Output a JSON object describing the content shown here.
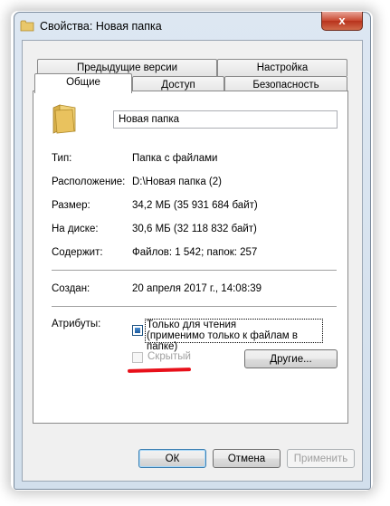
{
  "window": {
    "title": "Свойства: Новая папка",
    "close_label": "x"
  },
  "tabs": {
    "row_top": [
      "Предыдущие версии",
      "Настройка"
    ],
    "row_bottom": [
      "Общие",
      "Доступ",
      "Безопасность"
    ],
    "active": "Общие"
  },
  "general": {
    "name_value": "Новая папка",
    "type_label": "Тип:",
    "type_value": "Папка с файлами",
    "location_label": "Расположение:",
    "location_value": "D:\\Новая папка (2)",
    "size_label": "Размер:",
    "size_value": "34,2 МБ (35 931 684 байт)",
    "disk_label": "На диске:",
    "disk_value": "30,6 МБ (32 118 832 байт)",
    "contains_label": "Содержит:",
    "contains_value": "Файлов: 1 542; папок: 257",
    "created_label": "Создан:",
    "created_value": "20 апреля 2017 г., 14:08:39",
    "attributes_label": "Атрибуты:",
    "readonly_line1": "Только для чтения",
    "readonly_line2": "(применимо только к файлам в папке)",
    "readonly_state": "indeterminate",
    "hidden_label": "Скрытый",
    "hidden_checked": false,
    "other_button": "Другие..."
  },
  "footer": {
    "ok": "ОК",
    "cancel": "Отмена",
    "apply": "Применить"
  },
  "colors": {
    "highlight_underline": "#e8101a",
    "window_frame": "#d2dfec"
  }
}
